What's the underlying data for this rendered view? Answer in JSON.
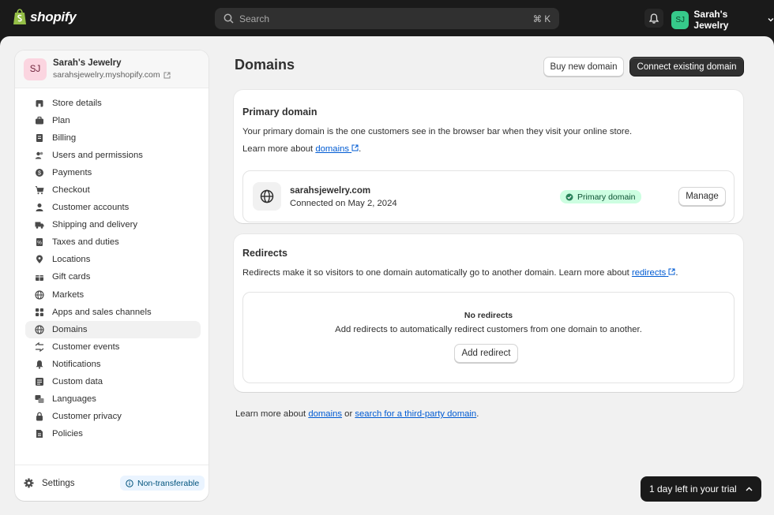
{
  "topbar": {
    "brand": "shopify",
    "search_placeholder": "Search",
    "search_shortcut": "⌘ K",
    "store_initials": "SJ",
    "store_name": "Sarah's Jewelry"
  },
  "sidebar": {
    "store_initials": "SJ",
    "store_name": "Sarah's Jewelry",
    "store_url": "sarahsjewelry.myshopify.com",
    "items": [
      {
        "label": "Store details",
        "icon": "store-icon"
      },
      {
        "label": "Plan",
        "icon": "briefcase-icon"
      },
      {
        "label": "Billing",
        "icon": "receipt-icon"
      },
      {
        "label": "Users and permissions",
        "icon": "users-icon"
      },
      {
        "label": "Payments",
        "icon": "dollar-icon"
      },
      {
        "label": "Checkout",
        "icon": "cart-icon"
      },
      {
        "label": "Customer accounts",
        "icon": "person-icon"
      },
      {
        "label": "Shipping and delivery",
        "icon": "truck-icon"
      },
      {
        "label": "Taxes and duties",
        "icon": "tax-icon"
      },
      {
        "label": "Locations",
        "icon": "pin-icon"
      },
      {
        "label": "Gift cards",
        "icon": "gift-icon"
      },
      {
        "label": "Markets",
        "icon": "globe-icon"
      },
      {
        "label": "Apps and sales channels",
        "icon": "apps-icon"
      },
      {
        "label": "Domains",
        "icon": "globe-icon",
        "active": true
      },
      {
        "label": "Customer events",
        "icon": "events-icon"
      },
      {
        "label": "Notifications",
        "icon": "bell-icon"
      },
      {
        "label": "Custom data",
        "icon": "data-icon"
      },
      {
        "label": "Languages",
        "icon": "language-icon"
      },
      {
        "label": "Customer privacy",
        "icon": "lock-icon"
      },
      {
        "label": "Policies",
        "icon": "document-icon"
      }
    ],
    "settings_label": "Settings",
    "non_transferable_label": "Non-transferable"
  },
  "page": {
    "title": "Domains",
    "buy_button": "Buy new domain",
    "connect_button": "Connect existing domain"
  },
  "primary": {
    "heading": "Primary domain",
    "description": "Your primary domain is the one customers see in the browser bar when they visit your online store.",
    "learn_prefix": "Learn more about ",
    "learn_link": "domains",
    "learn_suffix": ".",
    "domain": "sarahsjewelry.com",
    "connected": "Connected on May 2, 2024",
    "badge": "Primary domain",
    "manage_button": "Manage"
  },
  "redirects": {
    "heading": "Redirects",
    "description_prefix": "Redirects make it so visitors to one domain automatically go to another domain. Learn more about ",
    "link": "redirects",
    "description_suffix": ".",
    "empty_title": "No redirects",
    "empty_sub": "Add redirects to automatically redirect customers from one domain to another.",
    "add_button": "Add redirect"
  },
  "footer": {
    "prefix": "Learn more about ",
    "link1": "domains",
    "middle": " or ",
    "link2": "search for a third-party domain",
    "suffix": "."
  },
  "trial": {
    "label": "1 day left in your trial"
  },
  "colors": {
    "accent_link": "#005bd3",
    "badge_bg": "#cdfee1",
    "badge_text": "#0c5132",
    "primary_button": "#303030"
  }
}
